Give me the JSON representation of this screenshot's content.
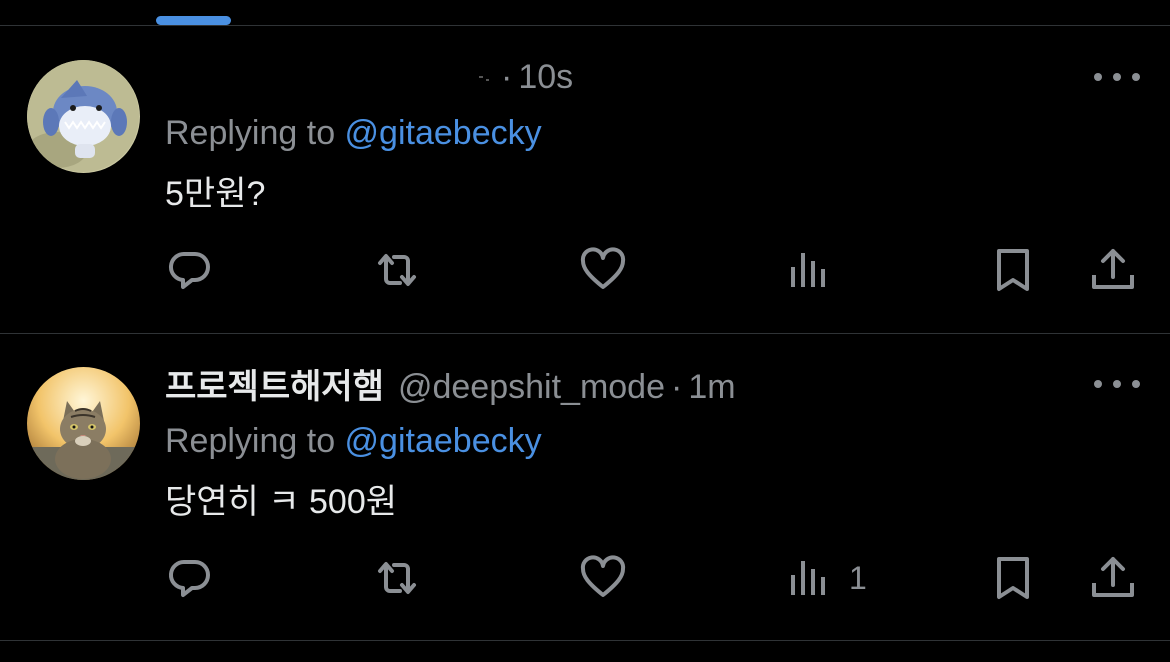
{
  "colors": {
    "background": "#000000",
    "accent": "#4a90e2",
    "muted": "#8b8f94",
    "text": "#e7e9ea",
    "divider": "#2f3336"
  },
  "tweets": [
    {
      "display_name": "",
      "handle": "",
      "dot": "·",
      "time": "10s",
      "replying_prefix": "Replying to ",
      "replying_handle": "@gitaebecky",
      "text": "5만원?",
      "avatar_icon": "shark-avatar",
      "views_count": ""
    },
    {
      "display_name": "프로젝트해저햄",
      "handle": "@deepshit_mode",
      "dot": "·",
      "time": "1m",
      "replying_prefix": "Replying to ",
      "replying_handle": "@gitaebecky",
      "text": "당연히 ㅋ 500원",
      "avatar_icon": "cat-avatar",
      "views_count": "1"
    }
  ],
  "icons": {
    "reply": "reply-icon",
    "retweet": "retweet-icon",
    "like": "heart-icon",
    "views": "views-icon",
    "bookmark": "bookmark-icon",
    "share": "share-icon",
    "more": "more-icon"
  }
}
